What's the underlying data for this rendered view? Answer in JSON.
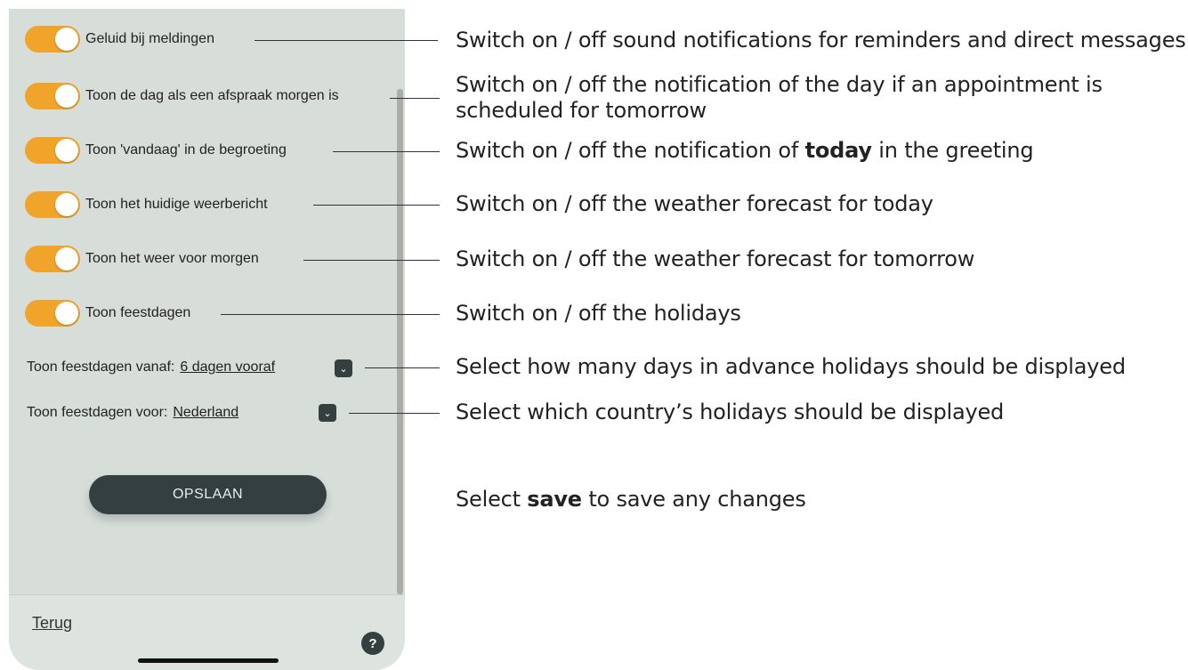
{
  "settings": {
    "toggles": [
      {
        "label": "Geluid bij meldingen",
        "on": true
      },
      {
        "label": "Toon de dag als een afspraak morgen is",
        "on": true
      },
      {
        "label": "Toon 'vandaag' in de begroeting",
        "on": true
      },
      {
        "label": "Toon het huidige weerbericht",
        "on": true
      },
      {
        "label": "Toon het weer voor morgen",
        "on": true
      },
      {
        "label": "Toon feestdagen",
        "on": true
      }
    ],
    "holidays_from": {
      "label": "Toon feestdagen vanaf:",
      "value": "6 dagen vooraf"
    },
    "holidays_country": {
      "label": "Toon feestdagen voor:",
      "value": "Nederland"
    },
    "save_label": "OPSLAAN"
  },
  "footer": {
    "back_label": "Terug",
    "help_label": "?"
  },
  "annotations": {
    "sound": "Switch on / off sound notifications for reminders and direct messages",
    "tomorrow_line1": "Switch on / off the notification of the day if an appointment is",
    "tomorrow_line2": "scheduled for tomorrow",
    "today_pre": "Switch on / off the notification of ",
    "today_bold": "today",
    "today_post": " in the greeting",
    "weather_today": "Switch on / off the weather forecast for today",
    "weather_tomorrow": "Switch on / off the weather forecast for tomorrow",
    "holidays": "Switch on / off the holidays",
    "days_advance": "Select how many days in advance holidays should be displayed",
    "country": "Select which country’s holidays should be displayed",
    "save_pre": "Select ",
    "save_bold": "save",
    "save_post": " to save any changes"
  },
  "colors": {
    "toggle_on": "#f0a42a",
    "panel_bg": "#d7ddd8",
    "button_dark": "#34403f"
  }
}
